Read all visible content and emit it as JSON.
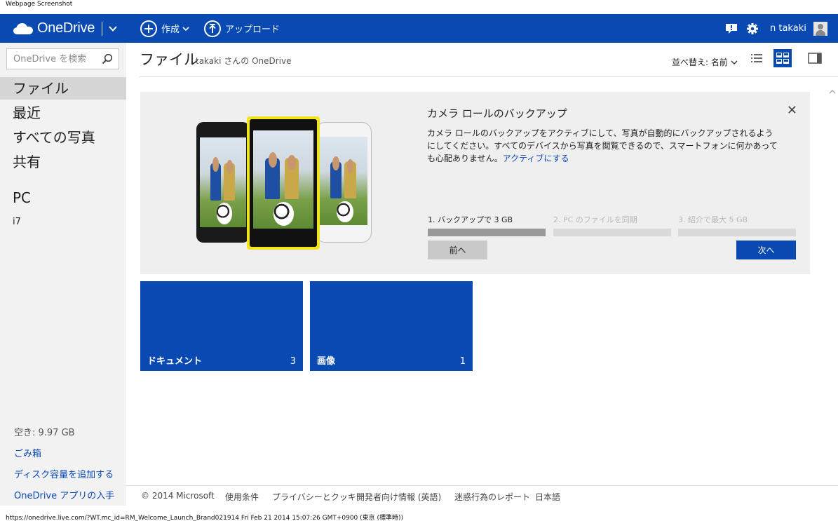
{
  "caption": "Webpage Screenshot",
  "header": {
    "brand": "OneDrive",
    "create_label": "作成",
    "upload_label": "アップロード",
    "user_name": "n takaki",
    "bg_color": "#094ab2"
  },
  "sidebar": {
    "search_placeholder": "OneDrive を検索",
    "items": [
      {
        "label": "ファイル"
      },
      {
        "label": "最近"
      },
      {
        "label": "すべての写真"
      },
      {
        "label": "共有"
      }
    ],
    "pc_heading": "PC",
    "pc_items": [
      {
        "label": "i7"
      }
    ],
    "free_space": "空き: 9.97 GB",
    "recycle_bin": "ごみ箱",
    "add_storage": "ディスク容量を追加する",
    "get_apps": "OneDrive アプリの入手"
  },
  "main": {
    "title": "ファイル",
    "subtitle": "takaki さんの OneDrive",
    "sort_label": "並べ替え: 名前"
  },
  "promo": {
    "title": "カメラ ロールのバックアップ",
    "text": "カメラ ロールのバックアップをアクティブにして、写真が自動的にバックアップされるようにしてください。すべてのデバイスから写真を閲覧できるので、スマートフォンに何かあっても心配ありません。",
    "link": "アクティブにする",
    "steps": [
      {
        "label": "1. バックアップで 3 GB"
      },
      {
        "label": "2. PC のファイルを同期"
      },
      {
        "label": "3. 紹介で最大 5 GB"
      }
    ],
    "prev_label": "前へ",
    "next_label": "次へ"
  },
  "tiles": [
    {
      "name": "ドキュメント",
      "count": "3"
    },
    {
      "name": "画像",
      "count": "1"
    }
  ],
  "footer": {
    "copyright": "© 2014 Microsoft",
    "terms": "使用条件",
    "privacy": "プライバシーとクッキー",
    "developers": "開発者向け情報 (英語)",
    "report_abuse": "迷惑行為のレポート",
    "language": "日本語"
  },
  "status_bar": "https://onedrive.live.com/?WT.mc_id=RM_Welcome_Launch_Brand021914 Fri Feb 21 2014 15:07:26 GMT+0900 (東京 (標準時))"
}
